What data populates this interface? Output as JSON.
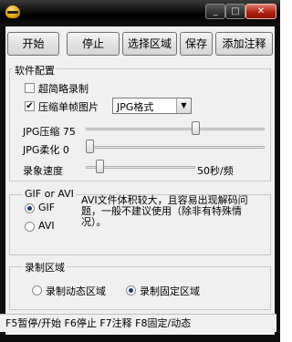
{
  "toolbar": {
    "start": "开始",
    "stop": "停止",
    "select_region": "选择区域",
    "save": "保存",
    "add_note": "添加注释"
  },
  "software_config": {
    "title": "软件配置",
    "ultra_simple": "超简略录制",
    "ultra_simple_checked": false,
    "compress_single": "压缩单帧图片",
    "compress_single_checked": true,
    "format": "JPG格式",
    "jpg_compress_label": "JPG压缩 75",
    "jpg_compress_value": 75,
    "jpg_soften_label": "JPG柔化 0",
    "jpg_soften_value": 0,
    "record_speed_label": "录象速度",
    "record_speed_value": "50秒/频"
  },
  "format_group": {
    "title": "GIF or AVI",
    "gif": "GIF",
    "avi": "AVI",
    "selected": "GIF",
    "note": "AVI文件体积较大，且容易出现解码问题，一般不建议使用（除非有特殊情况）。"
  },
  "region_group": {
    "title": "录制区域",
    "dynamic": "录制动态区域",
    "fixed": "录制固定区域",
    "selected": "fixed"
  },
  "status": "F5暂停/开始 F6停止 F7注释 F8固定/动态"
}
